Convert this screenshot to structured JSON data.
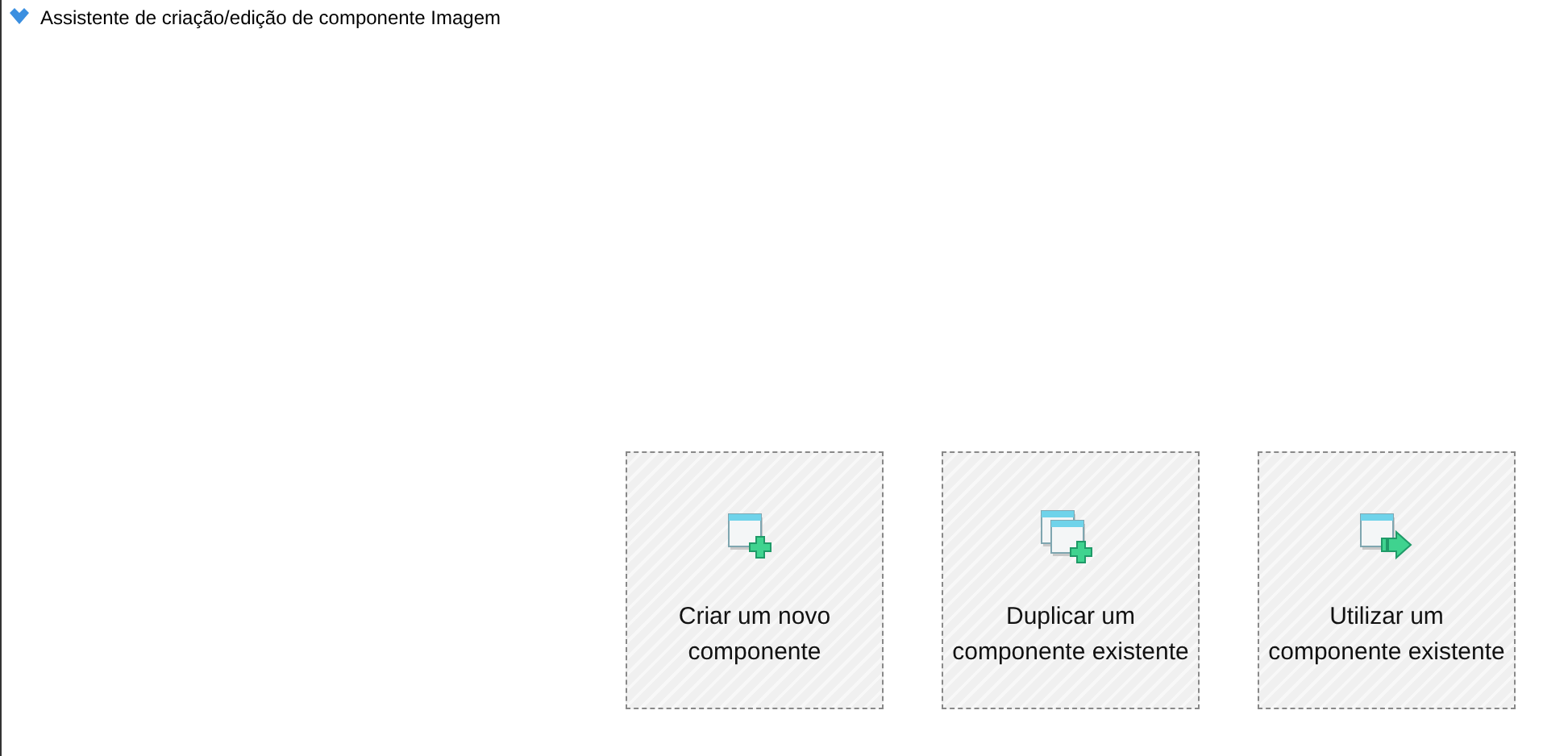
{
  "window": {
    "title": "Assistente de criação/edição de componente Imagem"
  },
  "options": [
    {
      "kind": "new",
      "label": "Criar um novo componente"
    },
    {
      "kind": "duplicate",
      "label": "Duplicar um componente existente"
    },
    {
      "kind": "use",
      "label": "Utilizar um componente existente"
    }
  ]
}
